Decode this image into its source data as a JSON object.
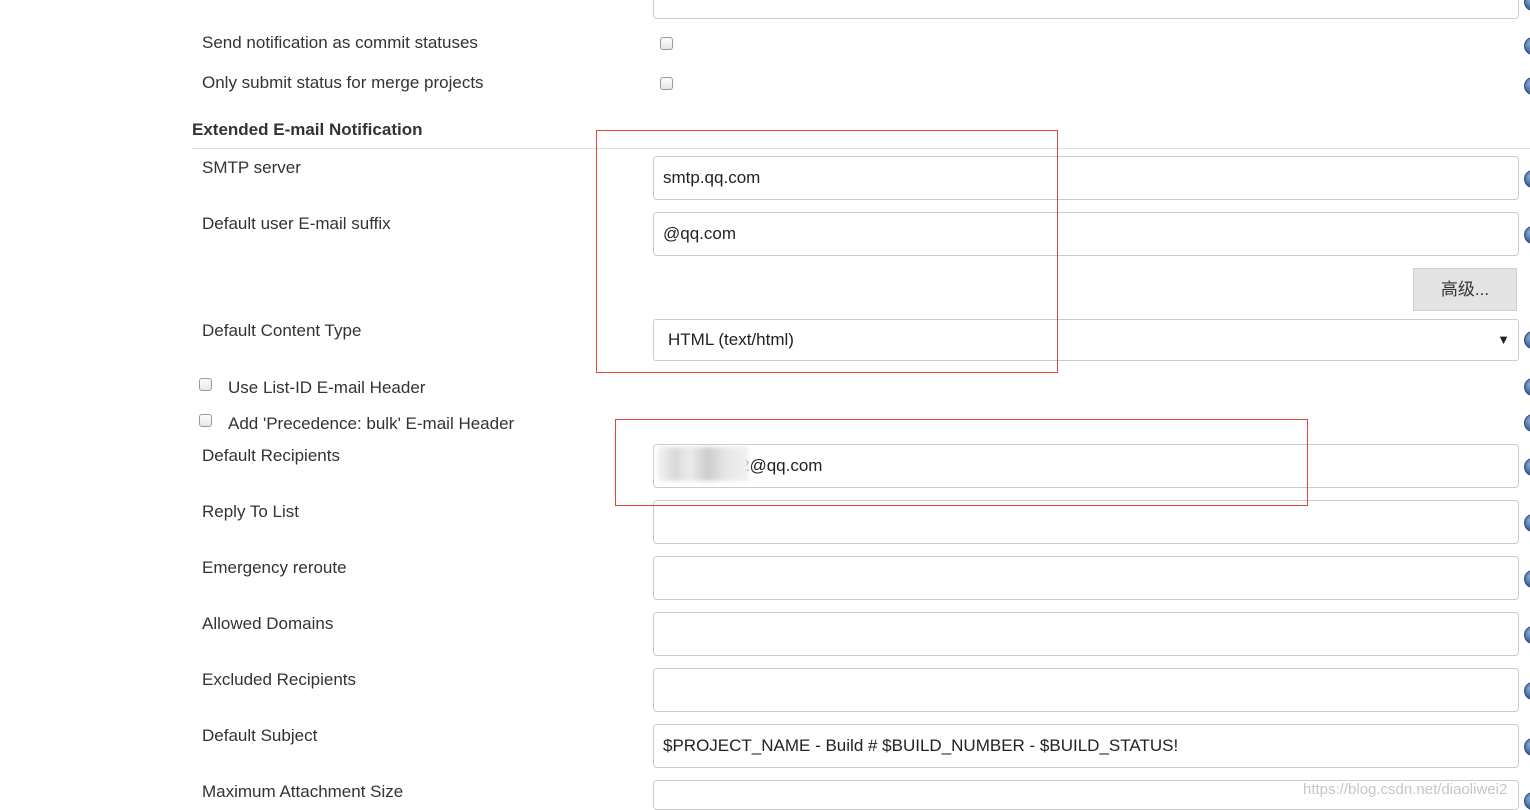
{
  "top_options": {
    "send_notification_label": "Send notification as commit statuses",
    "send_notification_checked": false,
    "merge_projects_label": "Only submit status for merge projects",
    "merge_projects_checked": false
  },
  "section": {
    "title": "Extended E-mail Notification"
  },
  "fields": {
    "smtp_server": {
      "label": "SMTP server",
      "value": "smtp.qq.com"
    },
    "default_suffix": {
      "label": "Default user E-mail suffix",
      "value": "@qq.com"
    },
    "advanced_button": "高级...",
    "content_type": {
      "label": "Default Content Type",
      "selected": "HTML (text/html)"
    },
    "list_id_header": {
      "label": "Use List-ID E-mail Header",
      "checked": false
    },
    "precedence_header": {
      "label": "Add 'Precedence: bulk' E-mail Header",
      "checked": false
    },
    "default_recipients": {
      "label": "Default Recipients",
      "value": "2@qq.com"
    },
    "reply_to": {
      "label": "Reply To List",
      "value": ""
    },
    "emergency_reroute": {
      "label": "Emergency reroute",
      "value": ""
    },
    "allowed_domains": {
      "label": "Allowed Domains",
      "value": ""
    },
    "excluded_recipients": {
      "label": "Excluded Recipients",
      "value": ""
    },
    "default_subject": {
      "label": "Default Subject",
      "value": "$PROJECT_NAME - Build # $BUILD_NUMBER - $BUILD_STATUS!"
    },
    "max_attachment": {
      "label": "Maximum Attachment Size",
      "value": ""
    }
  },
  "icons": {
    "help": "help-icon",
    "dropdown": "chevron-down-icon"
  },
  "colors": {
    "annotation_border": "#e0463b",
    "help_icon": "#4a6fa5"
  },
  "watermark": "https://blog.csdn.net/diaoliwei2"
}
